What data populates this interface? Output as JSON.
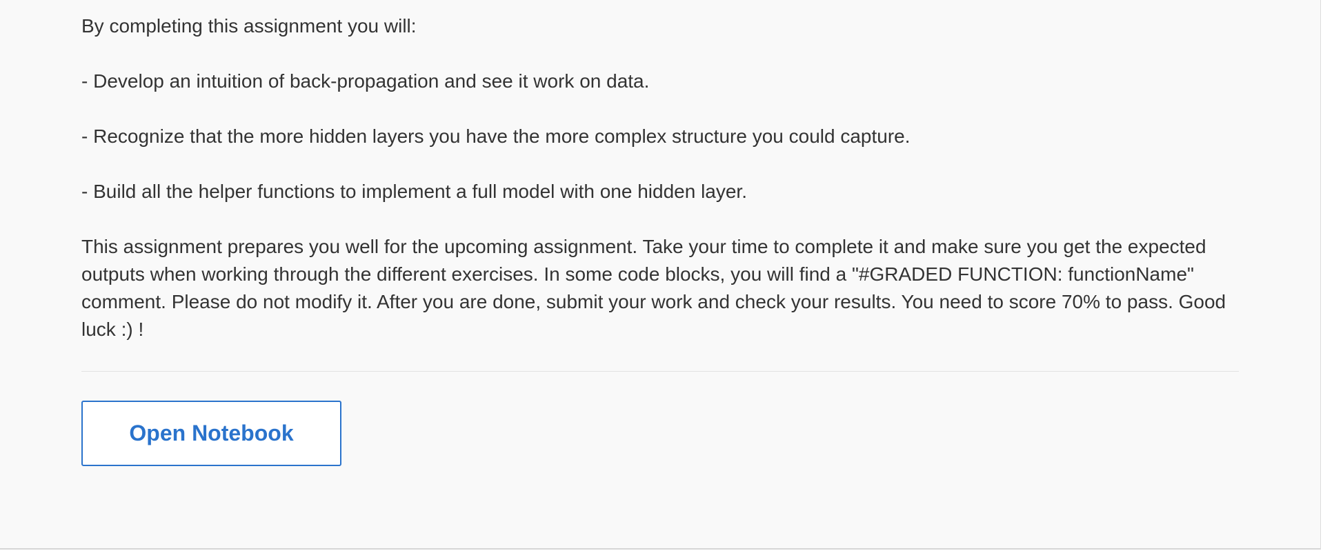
{
  "intro": {
    "heading": "By completing this assignment you will:",
    "bullets": [
      "- Develop an intuition of back-propagation and see it work on data.",
      "- Recognize that the more hidden layers you have the more complex structure you could capture.",
      "- Build all the helper functions to implement a full model with one hidden layer."
    ],
    "description": "This assignment prepares you well for the upcoming assignment. Take your time to complete it and make sure you get the expected outputs when working through the different exercises. In some code blocks, you will find a \"#GRADED FUNCTION: functionName\" comment. Please do not modify it. After you are done, submit your work and check your results. You need to score 70% to pass. Good luck :) !"
  },
  "actions": {
    "open_notebook_label": "Open Notebook"
  },
  "colors": {
    "accent": "#2a73cc",
    "text": "#333333",
    "background": "#f9f9f9"
  }
}
